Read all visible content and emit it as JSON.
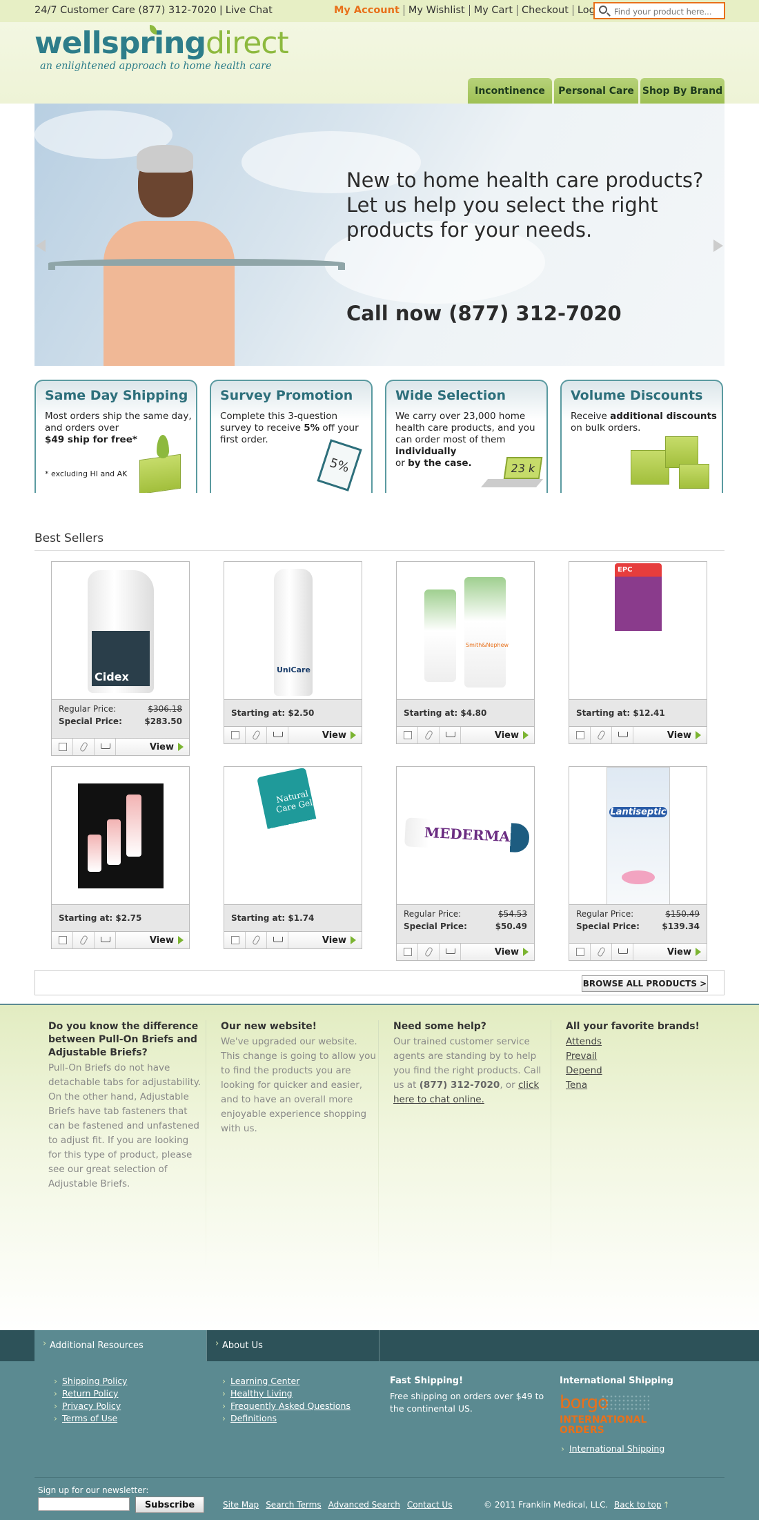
{
  "topbar": {
    "care_text": "24/7 Customer Care (877) 312-7020",
    "live_chat": "Live Chat",
    "links": [
      "My Account",
      "My Wishlist",
      "My Cart",
      "Checkout",
      "Log In"
    ],
    "search_placeholder": "Find your product here..."
  },
  "header": {
    "logo_word1": "wellspring",
    "logo_word2": "direct",
    "tagline": "an enlightened approach to home health care",
    "nav": [
      "Incontinence",
      "Personal Care",
      "Shop By Brand"
    ]
  },
  "hero": {
    "title": "New to home health care products? Let us help you select the right products for your needs.",
    "phone": "Call now (877) 312-7020"
  },
  "promos": [
    {
      "title": "Same Day Shipping",
      "text_a": "Most orders ship the same day, and orders over",
      "text_b": "$49 ship for free*",
      "note": "* excluding HI and AK"
    },
    {
      "title": "Survey Promotion",
      "text_a": "Complete this 3-question survey to receive",
      "bold": "5%",
      "text_b": "off your first order.",
      "badge": "5%"
    },
    {
      "title": "Wide Selection",
      "text_a": "We carry over 23,000 home health care products, and you can order most of them",
      "bold1": "individually",
      "mid": "or",
      "bold2": "by the case.",
      "badge": "23 k"
    },
    {
      "title": "Volume Discounts",
      "text_a": "Receive",
      "bold": "additional discounts",
      "text_b": "on bulk orders."
    }
  ],
  "best_sellers": {
    "title": "Best Sellers",
    "view_label": "View",
    "products": [
      {
        "type": "special",
        "regular_label": "Regular Price:",
        "regular": "$306.18",
        "special_label": "Special Price:",
        "special": "$283.50",
        "image": "Cidex OPA",
        "image_brand": "Cidex"
      },
      {
        "type": "starting",
        "label": "Starting at:",
        "price": "$2.50",
        "image": "UniCare",
        "image_brand": "UniCare"
      },
      {
        "type": "starting",
        "label": "Starting at:",
        "price": "$4.80",
        "image": "Moisturizing Cream tubes",
        "image_brand": "Smith&Nephew"
      },
      {
        "type": "starting",
        "label": "Starting at:",
        "price": "$12.41",
        "image": "Extra Protective Cream",
        "image_brand": "EPC"
      },
      {
        "type": "starting",
        "label": "Starting at:",
        "price": "$2.75",
        "image": "tube set",
        "image_brand": ""
      },
      {
        "type": "starting",
        "label": "Starting at:",
        "price": "$1.74",
        "image": "Natural Care Gel",
        "image_brand": "Natural Care Gel"
      },
      {
        "type": "special",
        "regular_label": "Regular Price:",
        "regular": "$54.53",
        "special_label": "Special Price:",
        "special": "$50.49",
        "image": "Mederma",
        "image_brand": "MEDERMA"
      },
      {
        "type": "special",
        "regular_label": "Regular Price:",
        "regular": "$150.49",
        "special_label": "Special Price:",
        "special": "$139.34",
        "image": "Lantiseptic",
        "image_brand": "Lantiseptic"
      }
    ],
    "browse_all": "BROWSE ALL PRODUCTS  >"
  },
  "info": [
    {
      "title": "Do you know the difference between Pull-On Briefs and Adjustable Briefs?",
      "body": "Pull-On Briefs do not have detachable tabs for adjustability. On the other hand, Adjustable Briefs have tab fasteners that can be fastened and unfastened to adjust fit. If you are looking for this type of product, please see our great selection of Adjustable Briefs."
    },
    {
      "title": "Our new website!",
      "body": "We've upgraded our website. This change is going to allow you to find the products you are looking for quicker and easier, and to have an overall more enjoyable experience shopping with us."
    },
    {
      "title": "Need some help?",
      "body_a": "Our trained customer service agents are standing by to help you find the right products. Call us at",
      "phone": "(877) 312-7020",
      "body_b": ", or",
      "link": "click here to chat online."
    },
    {
      "title": "All your favorite brands!",
      "brands": [
        "Attends",
        "Prevail",
        "Depend",
        "Tena"
      ]
    }
  ],
  "footer": {
    "tabs": [
      "Additional Resources",
      "About Us"
    ],
    "col1": [
      "Shipping Policy",
      "Return Policy",
      "Privacy Policy",
      "Terms of Use"
    ],
    "col2": [
      "Learning Center",
      "Healthy Living",
      "Frequently Asked Questions",
      "Definitions"
    ],
    "fast_title": "Fast Shipping!",
    "fast_text": "Free shipping on orders over $49 to the continental US.",
    "intl_title": "International Shipping",
    "intl_link": "International Shipping",
    "borgo_top": "borgo",
    "borgo_bottom": "INTERNATIONAL ORDERS",
    "newsletter_label": "Sign up for our newsletter:",
    "subscribe": "Subscribe",
    "bottom_links": [
      "Site Map",
      "Search Terms",
      "Advanced Search",
      "Contact Us"
    ],
    "copyright": "© 2011 Franklin Medical, LLC.",
    "back_to_top": "Back to top"
  },
  "colors": {
    "accent": "#8db93e",
    "brand": "#2d7d8a",
    "orange": "#e8701a",
    "footer": "#5b8a91"
  }
}
